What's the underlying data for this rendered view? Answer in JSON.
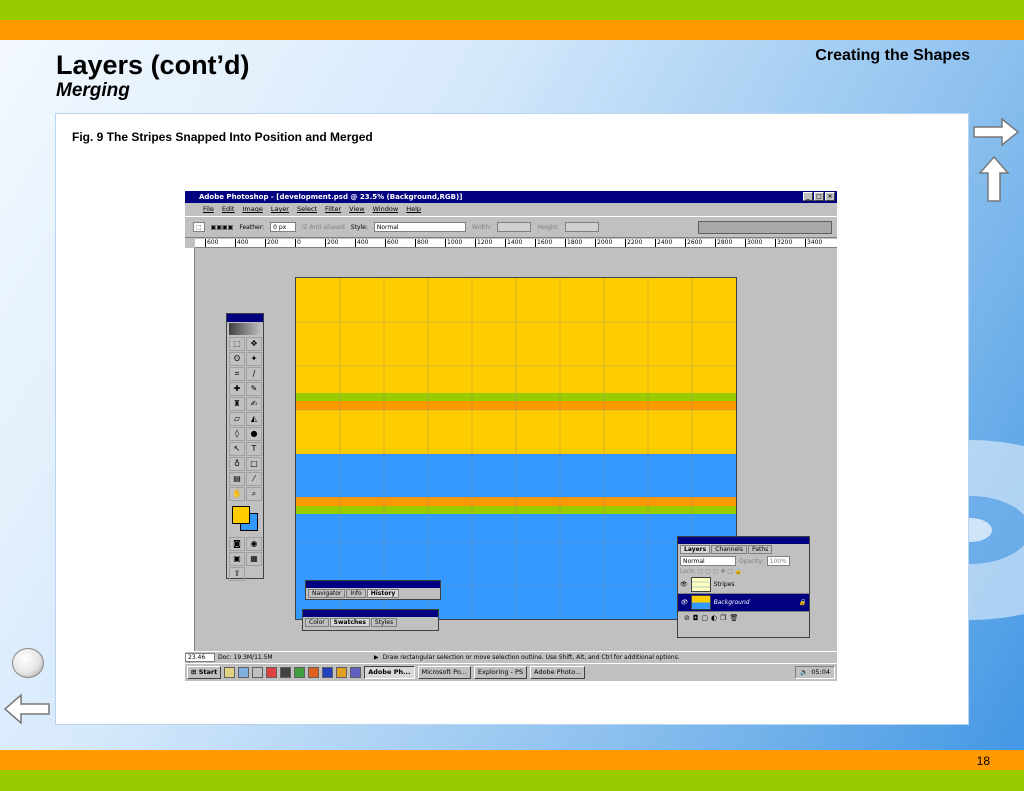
{
  "slide": {
    "title": "Layers (cont’d)",
    "subtitle": "Merging",
    "section": "Creating the Shapes",
    "caption": "Fig. 9  The Stripes Snapped Into Position and Merged",
    "page_number": "18"
  },
  "colors": {
    "green_band": "#99cc00",
    "orange_band": "#ff9900",
    "stripe_yellow": "#ffcc00",
    "stripe_green": "#99cc00",
    "stripe_orange": "#ff9900",
    "stripe_blue": "#3399ff",
    "titlebar": "#000080"
  },
  "photoshop": {
    "title": "Adobe Photoshop - [development.psd @ 23.5% (Background,RGB)]",
    "menu": [
      "File",
      "Edit",
      "Image",
      "Layer",
      "Select",
      "Filter",
      "View",
      "Window",
      "Help"
    ],
    "options": {
      "feather_label": "Feather:",
      "feather_value": "0 px",
      "antialiased_label": "Anti-aliased",
      "style_label": "Style:",
      "style_value": "Normal",
      "width_label": "Width:",
      "height_label": "Height:"
    },
    "ruler_labels": [
      "600",
      "400",
      "200",
      "0",
      "200",
      "400",
      "600",
      "800",
      "1000",
      "1200",
      "1400",
      "1600",
      "1800",
      "2000",
      "2200",
      "2400",
      "2600",
      "2800",
      "3000",
      "3200",
      "3400"
    ],
    "status": {
      "zoom": "23.46 %",
      "doc": "Doc: 19.3M/11.5M",
      "hint": "Draw rectangular selection or move selection outline.  Use Shift, Alt, and Ctrl for additional options."
    },
    "navigator_tabs": [
      "Navigator",
      "Info",
      "History"
    ],
    "color_tabs": [
      "Color",
      "Swatches",
      "Styles"
    ],
    "layers_panel": {
      "tabs": [
        "Layers",
        "Channels",
        "Paths"
      ],
      "blend_mode": "Normal",
      "opacity_label": "Opacity:",
      "opacity_value": "100%",
      "lock_label": "Lock:",
      "layers": [
        "Stripes",
        "Background"
      ]
    },
    "taskbar": {
      "start": "Start",
      "buttons": [
        "Adobe Ph...",
        "Microsoft Po...",
        "Exploring - PS",
        "Adobe Photo..."
      ],
      "clock": "05:04"
    }
  }
}
